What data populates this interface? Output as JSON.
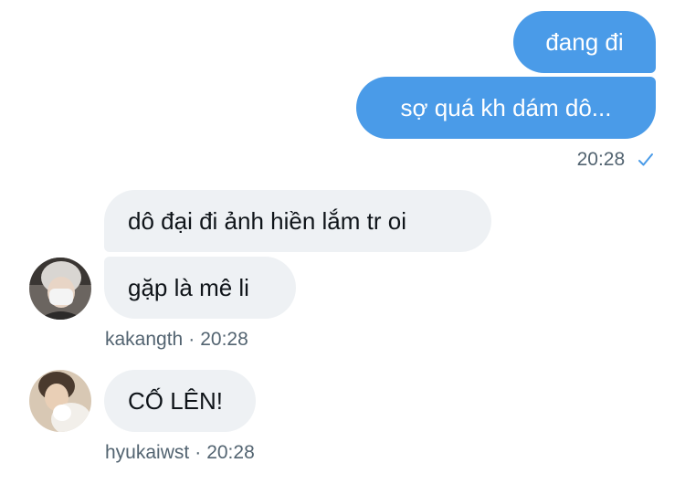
{
  "conversation": {
    "sent": [
      {
        "text": "đang đi"
      },
      {
        "text": "sợ quá kh dám dô..."
      }
    ],
    "sent_meta": {
      "time": "20:28",
      "status_icon": "check-icon"
    },
    "received_group_1": {
      "messages": [
        {
          "text": "dô đại đi ảnh hiền lắm tr oi"
        },
        {
          "text": "gặp là mê li"
        }
      ],
      "user": "kakangth",
      "separator": "·",
      "time": "20:28"
    },
    "received_group_2": {
      "messages": [
        {
          "text": "CỐ LÊN!"
        }
      ],
      "user": "hyukaiwst",
      "separator": "·",
      "time": "20:28"
    }
  },
  "colors": {
    "outgoing_bubble": "#4a9be8",
    "incoming_bubble": "#eef1f4",
    "meta_text": "#536471",
    "check": "#4a9be8"
  }
}
